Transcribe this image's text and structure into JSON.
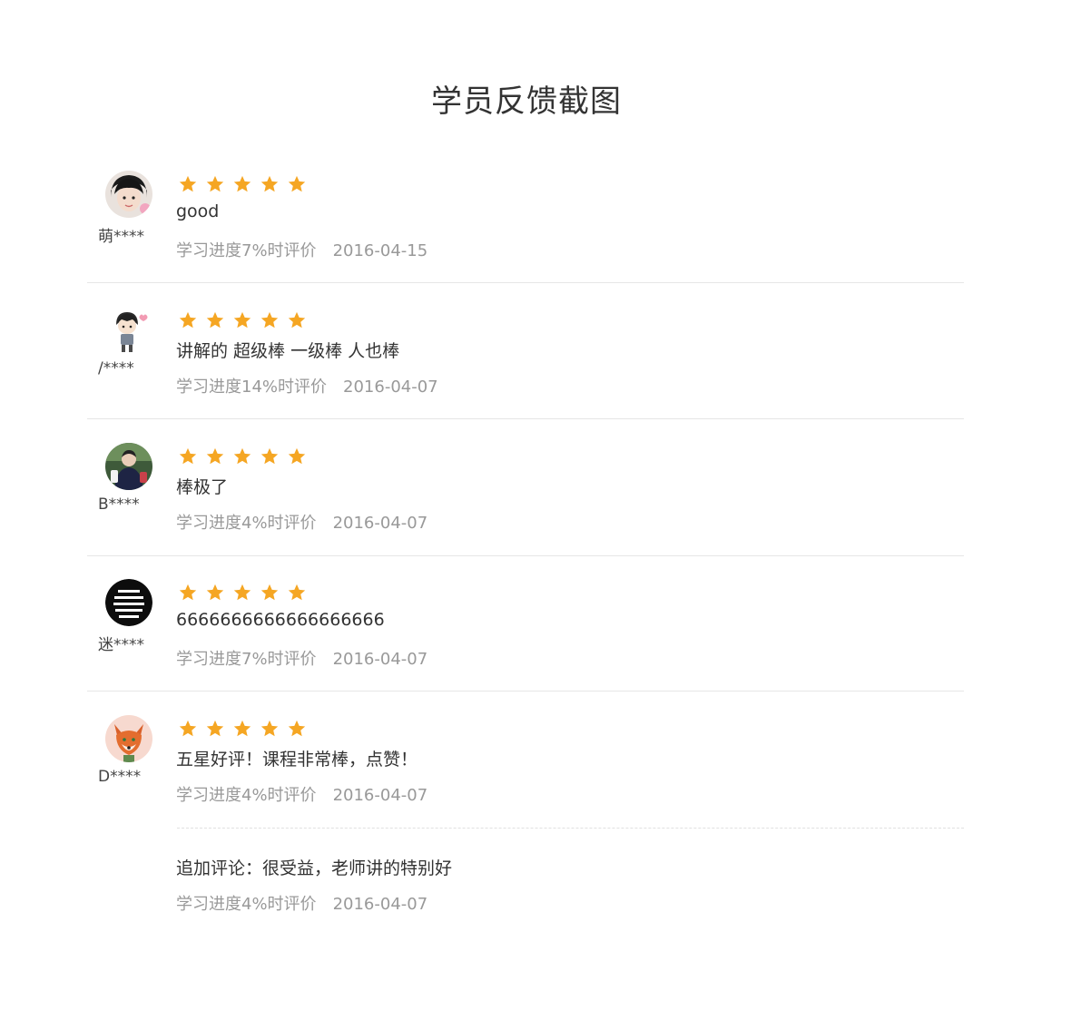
{
  "page": {
    "title": "学员反馈截图"
  },
  "colors": {
    "star": "#f5a623",
    "separator": "#e6e6e6",
    "meta": "#999999"
  },
  "reviews": [
    {
      "user": "萌****",
      "stars": 5,
      "comment": "good",
      "progress": "学习进度7%时评价",
      "date": "2016-04-15",
      "avatar_icon": "girl-avatar-icon"
    },
    {
      "user": "/****",
      "stars": 5,
      "comment": "讲解的 超级棒 一级棒 人也棒",
      "progress": "学习进度14%时评价",
      "date": "2016-04-07",
      "avatar_icon": "cartoon-boy-avatar-icon"
    },
    {
      "user": "B****",
      "stars": 5,
      "comment": "棒极了",
      "progress": "学习进度4%时评价",
      "date": "2016-04-07",
      "avatar_icon": "photo-avatar-icon"
    },
    {
      "user": "迷****",
      "stars": 5,
      "comment": "6666666666666666666",
      "progress": "学习进度7%时评价",
      "date": "2016-04-07",
      "avatar_icon": "text-badge-avatar-icon"
    },
    {
      "user": "D****",
      "stars": 5,
      "comment": "五星好评！课程非常棒，点赞！",
      "progress": "学习进度4%时评价",
      "date": "2016-04-07",
      "avatar_icon": "fox-avatar-icon"
    }
  ],
  "followup": {
    "comment": "追加评论：很受益，老师讲的特别好",
    "progress": "学习进度4%时评价",
    "date": "2016-04-07"
  }
}
